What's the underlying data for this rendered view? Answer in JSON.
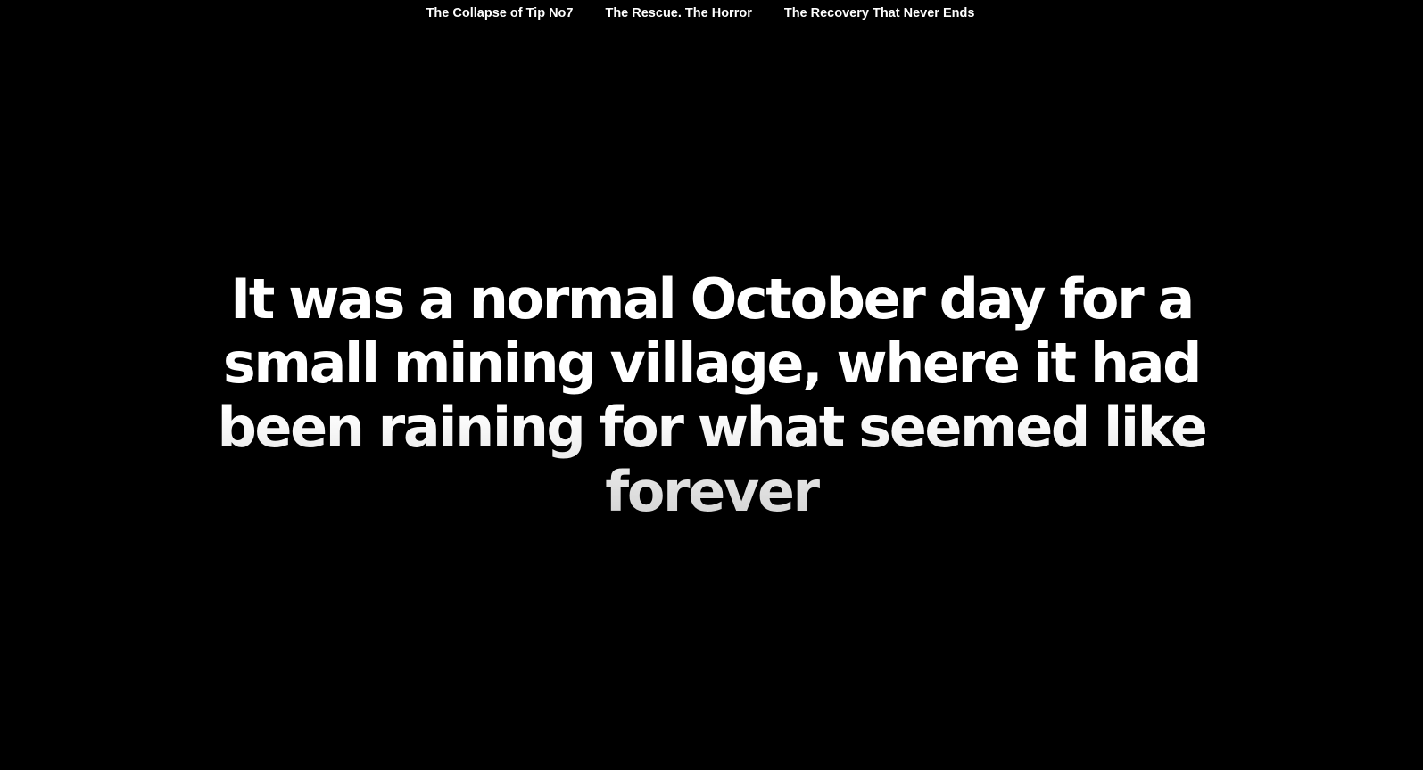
{
  "nav": {
    "items": [
      {
        "label": "The Collapse of Tip No7"
      },
      {
        "label": "The Rescue. The Horror"
      },
      {
        "label": "The Recovery That Never Ends"
      }
    ]
  },
  "hero": {
    "text": "It was a normal October day for a small mining village, where it had been raining for what seemed like forever"
  },
  "colors": {
    "background": "#000000",
    "text": "#ffffff"
  }
}
